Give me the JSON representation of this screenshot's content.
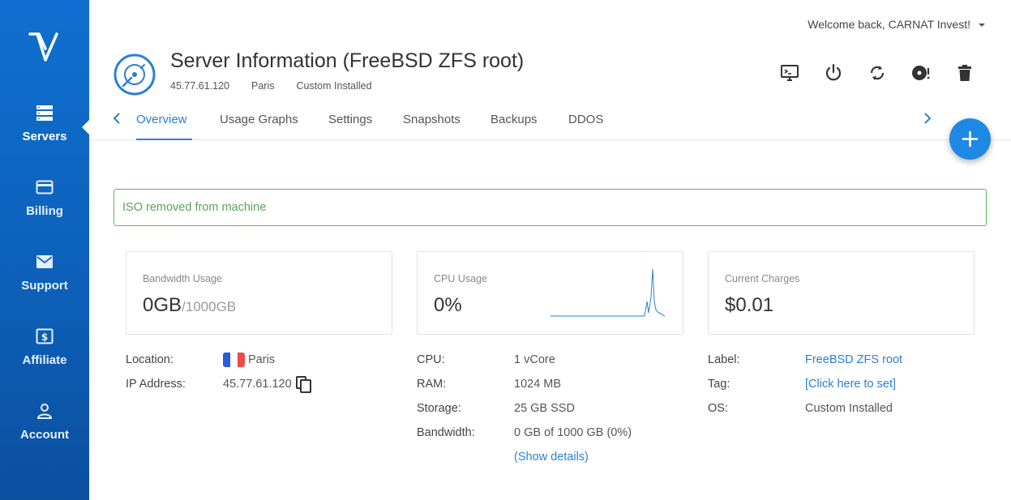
{
  "sidebar": {
    "items": [
      {
        "label": "Servers",
        "icon": "servers-icon",
        "active": true
      },
      {
        "label": "Billing",
        "icon": "credit-card-icon"
      },
      {
        "label": "Support",
        "icon": "envelope-icon"
      },
      {
        "label": "Affiliate",
        "icon": "dollar-icon"
      },
      {
        "label": "Account",
        "icon": "user-icon"
      }
    ]
  },
  "header": {
    "welcome": "Welcome back, CARNAT Invest!",
    "title": "Server Information (FreeBSD ZFS root)",
    "meta": {
      "ip": "45.77.61.120",
      "location": "Paris",
      "os": "Custom Installed"
    }
  },
  "actions": [
    "console-icon",
    "power-icon",
    "restart-icon",
    "iso-icon",
    "trash-icon"
  ],
  "tabs": [
    {
      "label": "Overview",
      "active": true
    },
    {
      "label": "Usage Graphs"
    },
    {
      "label": "Settings"
    },
    {
      "label": "Snapshots"
    },
    {
      "label": "Backups"
    },
    {
      "label": "DDOS"
    }
  ],
  "alert": {
    "message": "ISO removed from machine"
  },
  "cards": {
    "bandwidth": {
      "label": "Bandwidth Usage",
      "value": "0GB",
      "sub": "/1000GB"
    },
    "cpu": {
      "label": "CPU Usage",
      "value": "0%"
    },
    "charges": {
      "label": "Current Charges",
      "value": "$0.01"
    }
  },
  "details": {
    "location_label": "Location:",
    "location_value": "Paris",
    "ip_label": "IP Address:",
    "ip_value": "45.77.61.120",
    "cpu_label": "CPU:",
    "cpu_value": "1 vCore",
    "ram_label": "RAM:",
    "ram_value": "1024 MB",
    "storage_label": "Storage:",
    "storage_value": "25 GB SSD",
    "bandwidth_label": "Bandwidth:",
    "bandwidth_value": "0 GB of 1000 GB (0%)",
    "show_details": "(Show details)",
    "label_label": "Label:",
    "label_value": "FreeBSD ZFS root",
    "tag_label": "Tag:",
    "tag_value": "[Click here to set]",
    "os_label": "OS:",
    "os_value": "Custom Installed"
  },
  "colors": {
    "accent": "#1e88e5",
    "sidebar": "#0f6fd0",
    "success": "#5cb85c"
  }
}
